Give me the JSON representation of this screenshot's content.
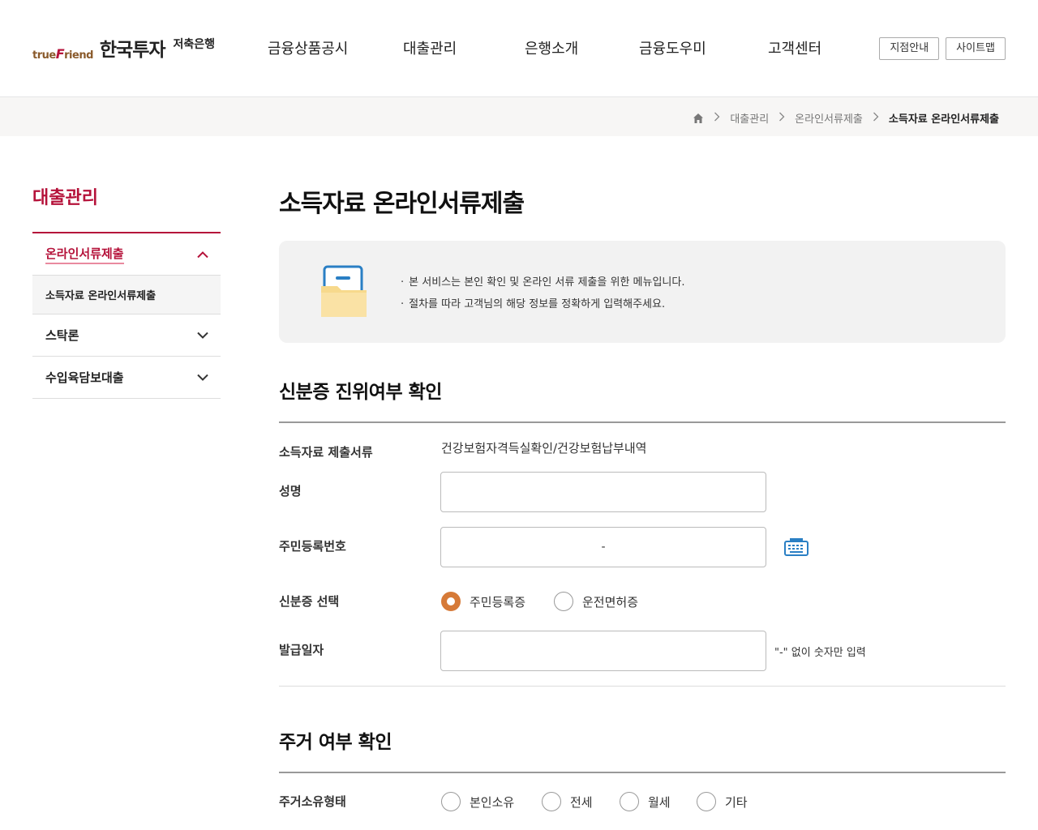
{
  "header": {
    "logo": {
      "prefix": "true",
      "prefix_f": "F",
      "prefix_rest": "riend",
      "main": "한국투자",
      "sub": "저축은행"
    },
    "nav": [
      "금융상품공시",
      "대출관리",
      "은행소개",
      "금융도우미",
      "고객센터"
    ],
    "util": {
      "branch": "지점안내",
      "sitemap": "사이트맵"
    }
  },
  "breadcrumb": {
    "items": [
      "대출관리",
      "온라인서류제출"
    ],
    "current": "소득자료 온라인서류제출"
  },
  "sidebar": {
    "title": "대출관리",
    "items": [
      {
        "label": "온라인서류제출",
        "sub": "소득자료 온라인서류제출"
      },
      {
        "label": "스탁론"
      },
      {
        "label": "수입육담보대출"
      }
    ]
  },
  "main": {
    "title": "소득자료 온라인서류제출",
    "info": [
      "본 서비스는 본인 확인 및 온라인 서류 제출을 위한 메뉴입니다.",
      "절차를 따라 고객님의 해당 정보를 정확하게 입력해주세요."
    ],
    "section1": {
      "title": "신분증 진위여부 확인",
      "doc_label": "소득자료 제출서류",
      "doc_value": "건강보험자격득실확인/건강보험납부내역",
      "name_label": "성명",
      "name_value": "",
      "rrn_label": "주민등록번호",
      "rrn_separator": "-",
      "id_label": "신분증 선택",
      "id_options": [
        "주민등록증",
        "운전면허증"
      ],
      "id_selected": "주민등록증",
      "issue_label": "발급일자",
      "issue_value": "",
      "issue_hint": "\"-\" 없이 숫자만 입력"
    },
    "section2": {
      "title": "주거 여부 확인",
      "housing_label": "주거소유형태",
      "housing_options": [
        "본인소유",
        "전세",
        "월세",
        "기타"
      ]
    }
  },
  "colors": {
    "brand": "#b5123a",
    "radio_accent": "#d67a38",
    "keyboard_icon": "#2a7fc4"
  },
  "icons": {
    "home": "home-icon",
    "keyboard": "keyboard-icon",
    "folder": "folder-document-icon",
    "chevron_up": "chevron-up-icon",
    "chevron_down": "chevron-down-icon",
    "breadcrumb_separator": "chevron-right-icon"
  }
}
